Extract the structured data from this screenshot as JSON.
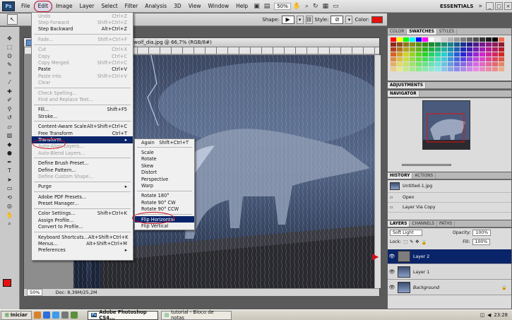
{
  "menubar": {
    "items": [
      "File",
      "Edit",
      "Image",
      "Layer",
      "Select",
      "Filter",
      "Analysis",
      "3D",
      "View",
      "Window",
      "Help"
    ],
    "zoom": "50%",
    "workspace": "ESSENTIALS"
  },
  "options_bar": {
    "shape_label": "Shape:",
    "style_label": "Style:",
    "color_label": "Color:",
    "color": "#e4120f"
  },
  "document": {
    "title": "wolf_dia.jpg @ 66,7% (RGB/8#)",
    "zoom": "50%",
    "doc_info": "Doc: 8,39M/25,2M"
  },
  "edit_menu": [
    {
      "label": "Undo",
      "key": "Ctrl+Z",
      "enabled": false
    },
    {
      "label": "Step Forward",
      "key": "Shift+Ctrl+Z",
      "enabled": false
    },
    {
      "label": "Step Backward",
      "key": "Alt+Ctrl+Z",
      "enabled": true
    },
    {
      "sep": true
    },
    {
      "label": "Fade...",
      "key": "Shift+Ctrl+F",
      "enabled": false
    },
    {
      "sep": true
    },
    {
      "label": "Cut",
      "key": "Ctrl+X",
      "enabled": false
    },
    {
      "label": "Copy",
      "key": "Ctrl+C",
      "enabled": false
    },
    {
      "label": "Copy Merged",
      "key": "Shift+Ctrl+C",
      "enabled": false
    },
    {
      "label": "Paste",
      "key": "Ctrl+V",
      "enabled": true
    },
    {
      "label": "Paste Into",
      "key": "Shift+Ctrl+V",
      "enabled": false
    },
    {
      "label": "Clear",
      "key": "",
      "enabled": false
    },
    {
      "sep": true
    },
    {
      "label": "Check Spelling...",
      "key": "",
      "enabled": false
    },
    {
      "label": "Find and Replace Text...",
      "key": "",
      "enabled": false
    },
    {
      "sep": true
    },
    {
      "label": "Fill...",
      "key": "Shift+F5",
      "enabled": true
    },
    {
      "label": "Stroke...",
      "key": "",
      "enabled": true
    },
    {
      "sep": true
    },
    {
      "label": "Content-Aware Scale",
      "key": "Alt+Shift+Ctrl+C",
      "enabled": true
    },
    {
      "label": "Free Transform",
      "key": "Ctrl+T",
      "enabled": true
    },
    {
      "label": "Transform",
      "key": "",
      "enabled": true,
      "submenu": true,
      "highlight": true
    },
    {
      "label": "Auto-Align Layers...",
      "key": "",
      "enabled": false
    },
    {
      "label": "Auto-Blend Layers...",
      "key": "",
      "enabled": false
    },
    {
      "sep": true
    },
    {
      "label": "Define Brush Preset...",
      "key": "",
      "enabled": true
    },
    {
      "label": "Define Pattern...",
      "key": "",
      "enabled": true
    },
    {
      "label": "Define Custom Shape...",
      "key": "",
      "enabled": false
    },
    {
      "sep": true
    },
    {
      "label": "Purge",
      "key": "",
      "enabled": true,
      "submenu": true
    },
    {
      "sep": true
    },
    {
      "label": "Adobe PDF Presets...",
      "key": "",
      "enabled": true
    },
    {
      "label": "Preset Manager...",
      "key": "",
      "enabled": true
    },
    {
      "sep": true
    },
    {
      "label": "Color Settings...",
      "key": "Shift+Ctrl+K",
      "enabled": true
    },
    {
      "label": "Assign Profile...",
      "key": "",
      "enabled": true
    },
    {
      "label": "Convert to Profile...",
      "key": "",
      "enabled": true
    },
    {
      "sep": true
    },
    {
      "label": "Keyboard Shortcuts...",
      "key": "Alt+Shift+Ctrl+K",
      "enabled": true
    },
    {
      "label": "Menus...",
      "key": "Alt+Shift+Ctrl+M",
      "enabled": true
    },
    {
      "label": "Preferences",
      "key": "",
      "enabled": true,
      "submenu": true
    }
  ],
  "transform_menu": [
    {
      "label": "Again",
      "key": "Shift+Ctrl+T",
      "enabled": true
    },
    {
      "sep": true
    },
    {
      "label": "Scale",
      "key": "",
      "enabled": true
    },
    {
      "label": "Rotate",
      "key": "",
      "enabled": true
    },
    {
      "label": "Skew",
      "key": "",
      "enabled": true
    },
    {
      "label": "Distort",
      "key": "",
      "enabled": true
    },
    {
      "label": "Perspective",
      "key": "",
      "enabled": true
    },
    {
      "label": "Warp",
      "key": "",
      "enabled": true
    },
    {
      "sep": true
    },
    {
      "label": "Rotate 180°",
      "key": "",
      "enabled": true
    },
    {
      "label": "Rotate 90° CW",
      "key": "",
      "enabled": true
    },
    {
      "label": "Rotate 90° CCW",
      "key": "",
      "enabled": true
    },
    {
      "sep": true
    },
    {
      "label": "Flip Horizontal",
      "key": "",
      "enabled": true,
      "highlight": true
    },
    {
      "label": "Flip Vertical",
      "key": "",
      "enabled": true
    }
  ],
  "panels": {
    "color_tabs": [
      "COLOR",
      "SWATCHES",
      "STYLES"
    ],
    "adjustments_tab": "ADJUSTMENTS",
    "navigator_tab": "NAVIGATOR",
    "history_tabs": [
      "HISTORY",
      "ACTIONS"
    ],
    "history_items": [
      "Untitled-1.jpg",
      "Open",
      "Layer Via Copy"
    ],
    "layers_tabs": [
      "LAYERS",
      "CHANNELS",
      "PATHS"
    ],
    "blend_mode": "Soft Light",
    "opacity_label": "Opacity:",
    "opacity": "100%",
    "lock_label": "Lock:",
    "fill_label": "Fill:",
    "fill": "100%",
    "layers": [
      {
        "name": "Layer 2",
        "selected": true
      },
      {
        "name": "Layer 1",
        "selected": false
      },
      {
        "name": "Background",
        "selected": false
      }
    ]
  },
  "taskbar": {
    "start": "Iniciar",
    "tasks": [
      "Adobe Photoshop CS4...",
      "tutorial - Bloco de notas"
    ],
    "clock": "23:28"
  },
  "swatch_colors": [
    "#ff0000",
    "#ffff00",
    "#00ff00",
    "#00ffff",
    "#0000ff",
    "#ff00ff",
    "#ffffff",
    "#e6e6e6",
    "#cccccc",
    "#b3b3b3",
    "#999999",
    "#808080",
    "#666666",
    "#4d4d4d",
    "#333333",
    "#1a1a1a",
    "#000000",
    "#f26c4f"
  ]
}
